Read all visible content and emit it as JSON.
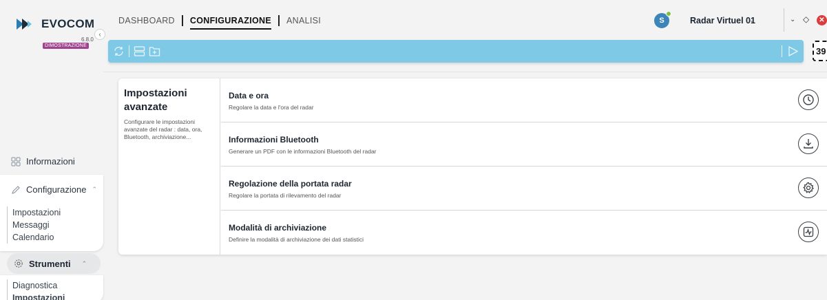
{
  "brand": {
    "name": "EVOCOM",
    "version": "6.8.0",
    "badge": "DIMOSTRAZIONE"
  },
  "colors": {
    "toolbar": "#7ec9e6",
    "brand_badge": "#a0438f",
    "close": "#d93d3d",
    "avatar": "#3d84b8"
  },
  "top_nav": {
    "tabs": [
      {
        "label": "DASHBOARD",
        "active": false
      },
      {
        "label": "CONFIGURAZIONE",
        "active": true
      },
      {
        "label": "ANALISI",
        "active": false
      }
    ]
  },
  "user": {
    "avatar_initial": "S",
    "radar_name": "Radar Virtuel 01"
  },
  "toolbar": {
    "icons": [
      "sync-icon",
      "storage-icon",
      "add-folder-icon",
      "send-icon"
    ],
    "counter": "39"
  },
  "sidebar": {
    "informazioni": "Informazioni",
    "configurazione": "Configurazione",
    "config_items": [
      "Impostazioni",
      "Messaggi",
      "Calendario"
    ],
    "strumenti": "Strumenti",
    "strumenti_items": [
      "Diagnostica",
      "Impostazioni"
    ]
  },
  "panel": {
    "title": "Impostazioni avanzate",
    "description": "Configurare le impostazioni avanzate del radar : data, ora, Bluetooth, archiviazione...",
    "rows": [
      {
        "title": "Data e ora",
        "description": "Regolare la data e l'ora del radar",
        "icon": "clock-icon"
      },
      {
        "title": "Informazioni Bluetooth",
        "description": "Generare un PDF con le informazioni Bluetooth del radar",
        "icon": "download-icon"
      },
      {
        "title": "Regolazione della portata radar",
        "description": "Regolare la portata di rilevamento del radar",
        "icon": "gear-icon"
      },
      {
        "title": "Modalità di archiviazione",
        "description": "Definire la modalità di archiviazione dei dati statistici",
        "icon": "chart-icon"
      }
    ]
  }
}
